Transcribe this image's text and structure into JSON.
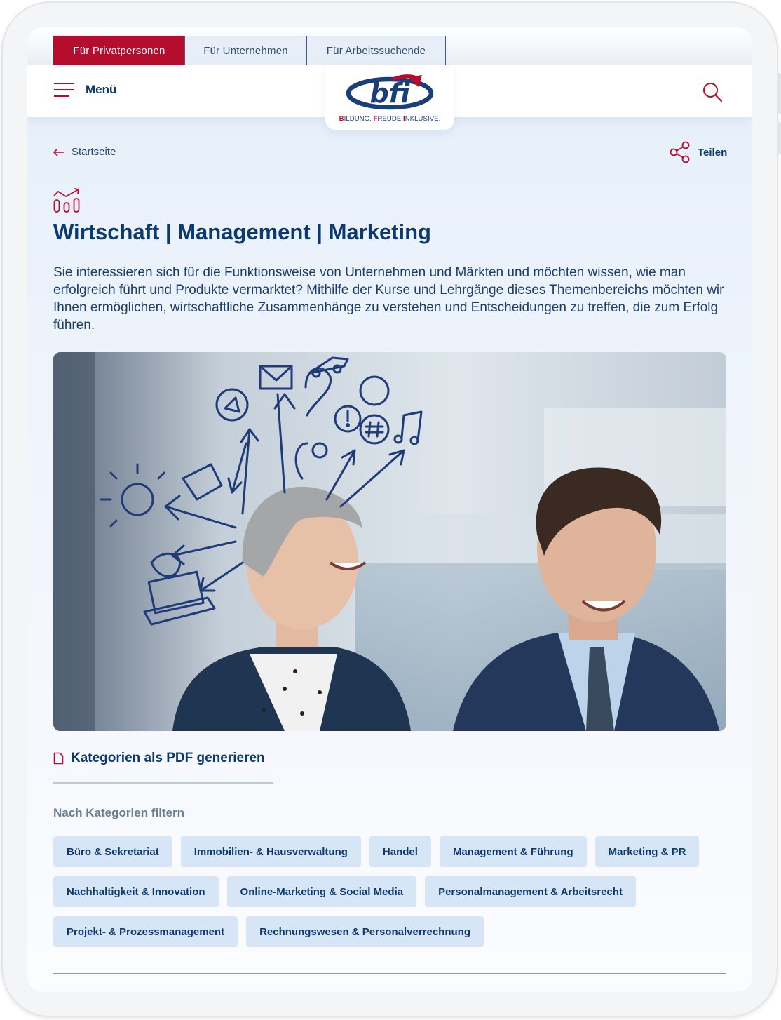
{
  "audience_tabs": [
    {
      "label": "Für Privatpersonen",
      "active": true
    },
    {
      "label": "Für Unternehmen",
      "active": false
    },
    {
      "label": "Für Arbeitssuchende",
      "active": false
    }
  ],
  "header": {
    "menu_label": "Menü",
    "logo_text": "bfi",
    "tagline": {
      "b1": "B",
      "r1": "ILDUNG. ",
      "b2": "F",
      "r2": "REUDE ",
      "b3": "I",
      "r3": "NKLUSIVE."
    }
  },
  "breadcrumb": {
    "back_label": "Startseite"
  },
  "share": {
    "label": "Teilen"
  },
  "page": {
    "title": "Wirtschaft | Management | Marketing",
    "intro": "Sie interessieren sich für die Funktionsweise von Unternehmen und Märkten und möchten wissen, wie man erfolgreich führt und Produkte vermarktet? Mithilfe der Kurse und Lehrgänge dieses Themenbereichs möchten wir Ihnen ermöglichen, wirtschaftliche Zusammenhänge zu verstehen und Entscheidungen zu treffen, die zum Erfolg führen."
  },
  "pdf": {
    "label": "Kategorien als PDF generieren"
  },
  "filter": {
    "label": "Nach Kategorien filtern",
    "categories": [
      "Büro & Sekretariat",
      "Immobilien- & Hausverwaltung",
      "Handel",
      "Management & Führung",
      "Marketing & PR",
      "Nachhaltigkeit & Innovation",
      "Online-Marketing & Social Media",
      "Personalmanagement & Arbeitsrecht",
      "Projekt- & Prozessmanagement",
      "Rechnungswesen & Personalverrechnung"
    ]
  },
  "colors": {
    "brand_red": "#b50d2e",
    "brand_blue": "#0d3a6e",
    "chip_bg": "#d7e6f6"
  },
  "icons": [
    "hamburger-icon",
    "search-icon",
    "arrow-left-icon",
    "share-icon",
    "growth-chart-icon",
    "document-icon"
  ]
}
